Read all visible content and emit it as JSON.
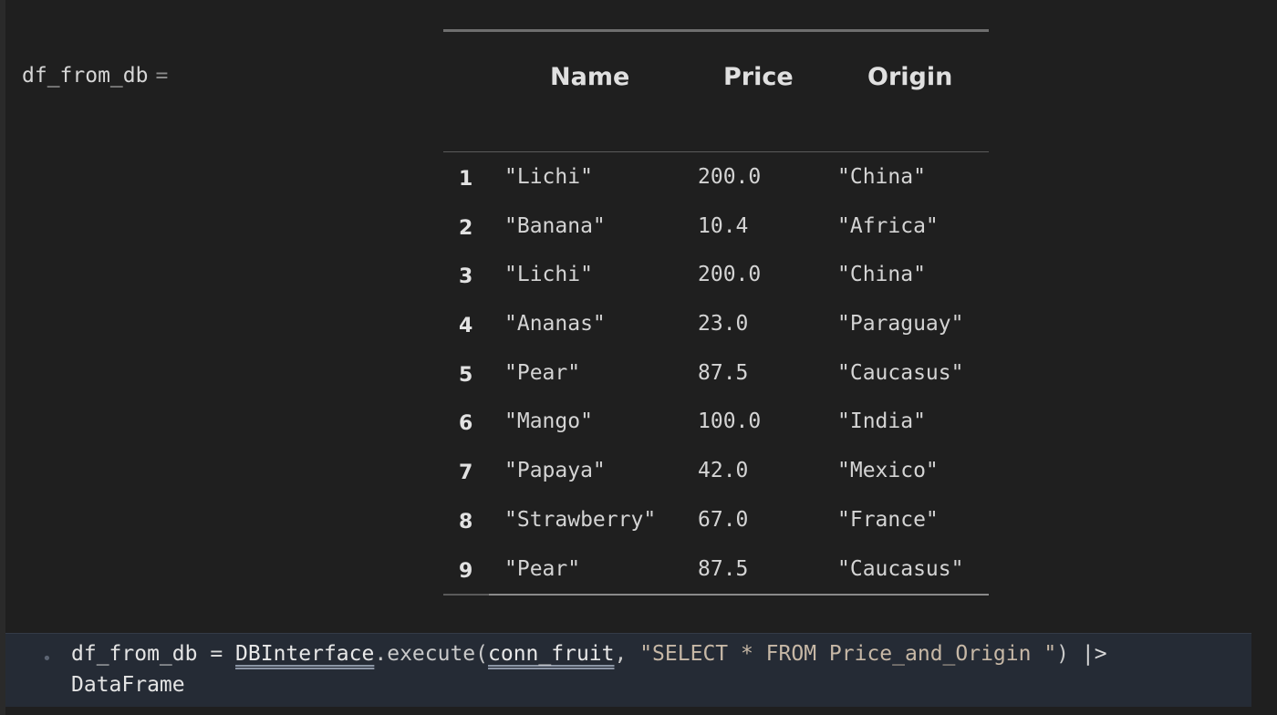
{
  "output": {
    "variable": "df_from_db",
    "equals": "="
  },
  "table": {
    "columns": [
      "Name",
      "Price",
      "Origin"
    ],
    "rows": [
      {
        "index": "1",
        "name": "\"Lichi\"",
        "price": "200.0",
        "origin": "\"China\""
      },
      {
        "index": "2",
        "name": "\"Banana\"",
        "price": "10.4",
        "origin": "\"Africa\""
      },
      {
        "index": "3",
        "name": "\"Lichi\"",
        "price": "200.0",
        "origin": "\"China\""
      },
      {
        "index": "4",
        "name": "\"Ananas\"",
        "price": "23.0",
        "origin": "\"Paraguay\""
      },
      {
        "index": "5",
        "name": "\"Pear\"",
        "price": "87.5",
        "origin": "\"Caucasus\""
      },
      {
        "index": "6",
        "name": "\"Mango\"",
        "price": "100.0",
        "origin": "\"India\""
      },
      {
        "index": "7",
        "name": "\"Papaya\"",
        "price": "42.0",
        "origin": "\"Mexico\""
      },
      {
        "index": "8",
        "name": "\"Strawberry\"",
        "price": "67.0",
        "origin": "\"France\""
      },
      {
        "index": "9",
        "name": "\"Pear\"",
        "price": "87.5",
        "origin": "\"Caucasus\""
      }
    ]
  },
  "code": {
    "bullet": "•",
    "var": "df_from_db",
    "assign": " = ",
    "type": "DBInterface",
    "dot": ".",
    "fn": "execute",
    "open": "(",
    "arg1": "conn_fruit",
    "comma": ", ",
    "query": "\"SELECT * FROM Price_and_Origin \"",
    "close": ")",
    "pipe": " |>",
    "line2": "DataFrame"
  },
  "colors": {
    "background": "#1f1f1f",
    "code_cell_background": "#252b35",
    "string": "#c7b8a6"
  }
}
